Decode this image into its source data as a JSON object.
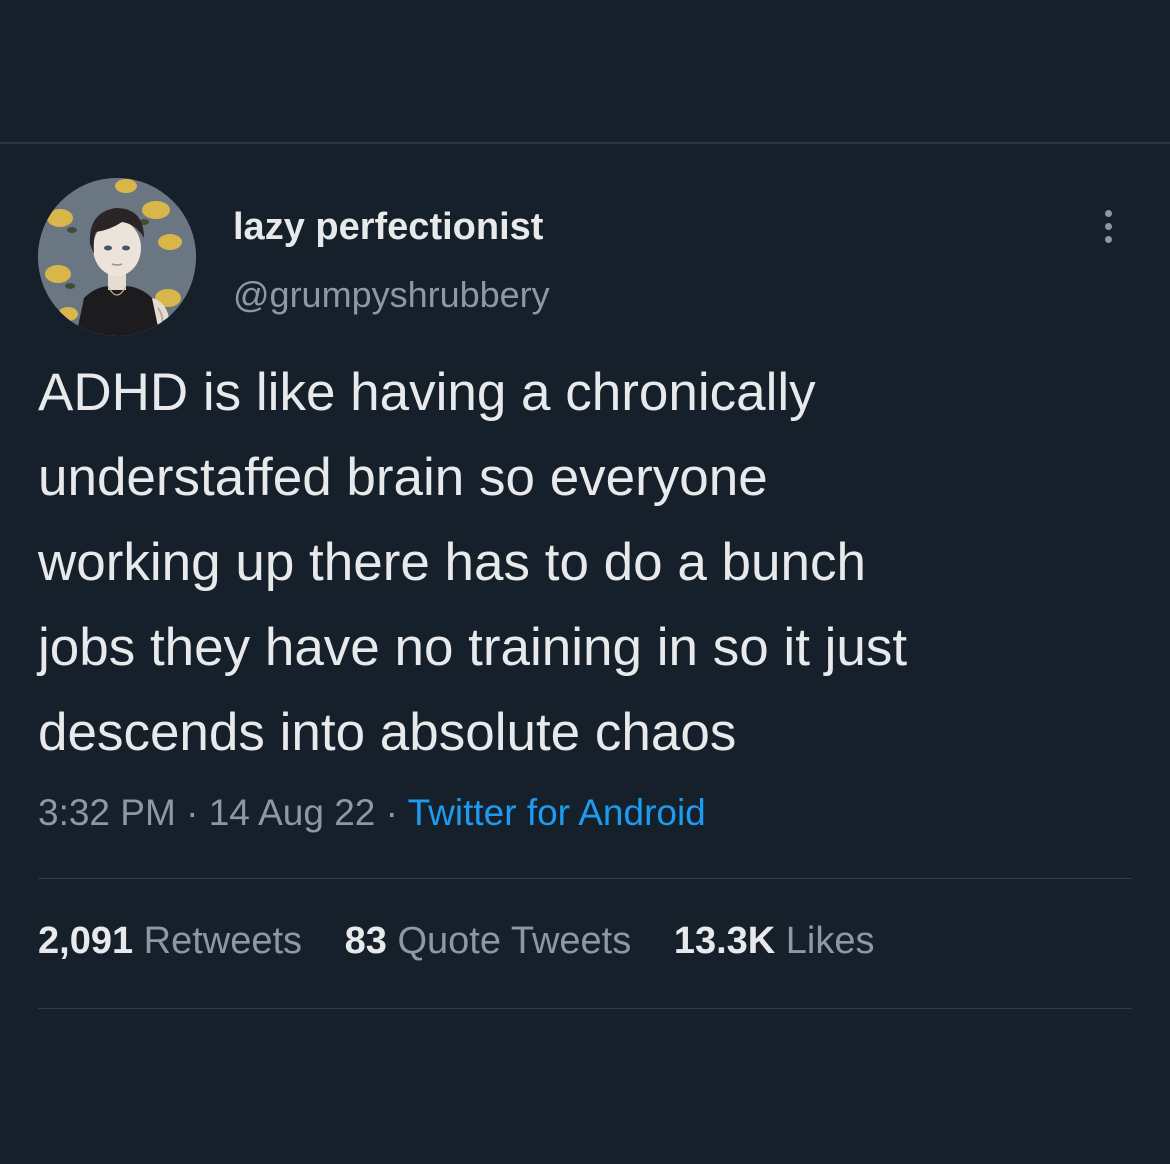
{
  "author": {
    "display_name": "lazy perfectionist",
    "handle": "@grumpyshrubbery",
    "avatar_icon": "illustrated-portrait-avatar"
  },
  "more_icon": "more-options-icon",
  "tweet": {
    "lines": [
      "ADHD is like having a chronically",
      "understaffed brain so everyone",
      "working up there has to do a bunch",
      "jobs they have no training in so it just",
      "descends into absolute chaos"
    ]
  },
  "meta": {
    "time": "3:32 PM",
    "separator": " · ",
    "date": "14 Aug 22",
    "source": "Twitter for Android"
  },
  "stats": {
    "retweets_count": "2,091",
    "retweets_label": "Retweets",
    "quotes_count": "83",
    "quotes_label": "Quote Tweets",
    "likes_count": "13.3K",
    "likes_label": "Likes"
  },
  "colors": {
    "background": "#15202b",
    "primary_text": "#e7e9ea",
    "secondary_text": "#8b98a5",
    "link": "#1d9bf0"
  }
}
